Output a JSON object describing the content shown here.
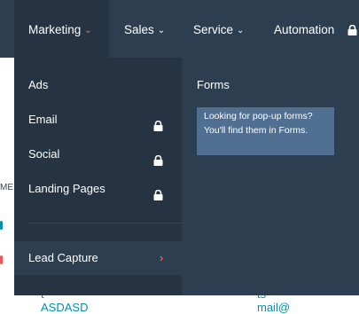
{
  "nav": {
    "items": [
      {
        "label": "Marketing",
        "active": true
      },
      {
        "label": "Sales",
        "active": false
      },
      {
        "label": "Service",
        "active": false
      },
      {
        "label": "Automation",
        "active": false
      }
    ],
    "caret_glyph": "⌄",
    "lock_icon": "lock-icon"
  },
  "dropdown": {
    "left_items": [
      {
        "label": "Ads",
        "locked": false
      },
      {
        "label": "Email",
        "locked": true
      },
      {
        "label": "Social",
        "locked": true
      },
      {
        "label": "Landing Pages",
        "locked": true
      }
    ],
    "lead_capture": {
      "label": "Lead Capture",
      "chevron": "›"
    },
    "right": {
      "heading": "Forms",
      "tip": "Looking for pop-up forms? You'll find them in Forms."
    }
  },
  "background": {
    "me": "ME",
    "co": "co",
    "ng": "ng",
    "bottom_left": "t ASDASD",
    "bottom_right": "ts mail@"
  },
  "colors": {
    "nav_bg": "#2d3e50",
    "dropdown_left_bg": "#253342",
    "tip_bg": "#516f90",
    "accent": "#ff7a59",
    "link": "#0091ae"
  }
}
